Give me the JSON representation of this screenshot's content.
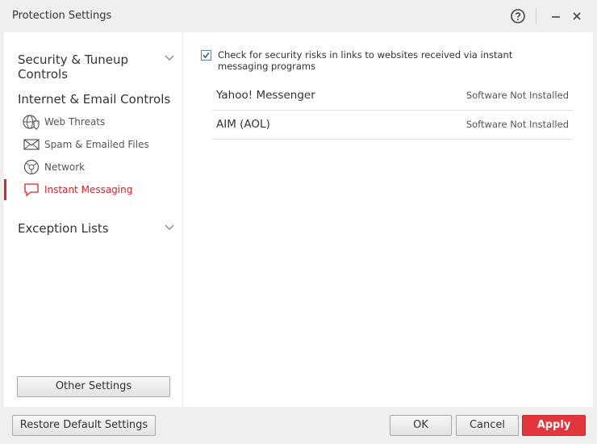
{
  "window": {
    "title": "Protection Settings"
  },
  "sidebar": {
    "sections": [
      {
        "label_line1": "Security & Tuneup",
        "label_line2": "Controls"
      },
      {
        "label": "Internet & Email Controls"
      },
      {
        "label": "Exception Lists"
      }
    ],
    "items": [
      {
        "label": "Web Threats",
        "icon": "globe-shield-icon"
      },
      {
        "label": "Spam & Emailed Files",
        "icon": "envelope-icon"
      },
      {
        "label": "Network",
        "icon": "network-globe-icon"
      },
      {
        "label": "Instant Messaging",
        "icon": "chat-bubble-icon",
        "active": true
      }
    ],
    "other_settings_label": "Other Settings"
  },
  "main": {
    "checkbox": {
      "checked": true,
      "label": "Check for security risks in links to websites received via instant messaging programs"
    },
    "programs": [
      {
        "name": "Yahoo! Messenger",
        "status": "Software Not Installed"
      },
      {
        "name": "AIM (AOL)",
        "status": "Software Not Installed"
      }
    ]
  },
  "footer": {
    "restore_label": "Restore Default Settings",
    "ok_label": "OK",
    "cancel_label": "Cancel",
    "apply_label": "Apply"
  },
  "colors": {
    "accent": "#d7262d",
    "apply_button": "#e2363c"
  }
}
